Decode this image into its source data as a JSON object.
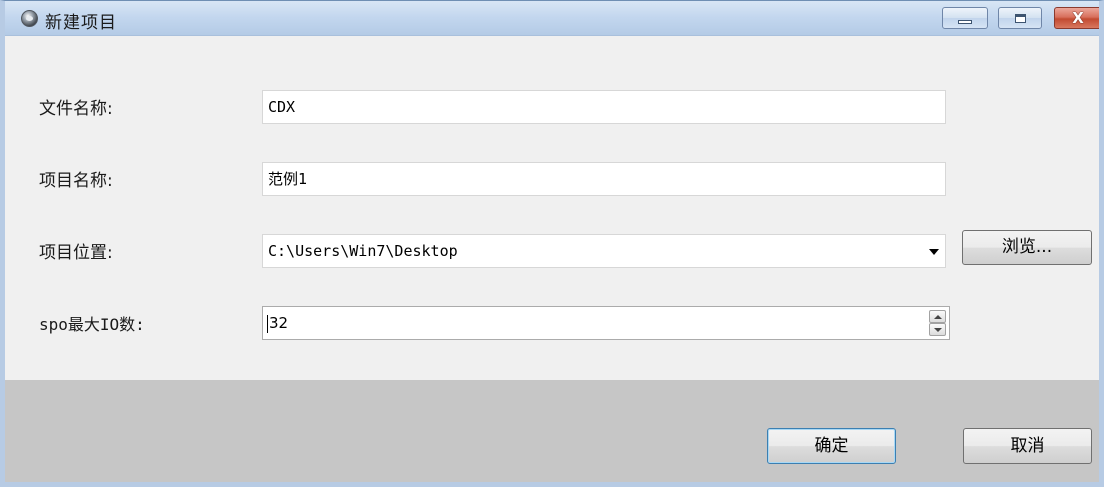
{
  "window": {
    "title": "新建项目",
    "controls": {
      "minimize": "minimize",
      "maximize": "maximize",
      "close": "X"
    }
  },
  "form": {
    "file_name": {
      "label": "文件名称:",
      "value": "CDX"
    },
    "project_name": {
      "label": "项目名称:",
      "value": "范例1"
    },
    "project_location": {
      "label": "项目位置:",
      "value": "C:\\Users\\Win7\\Desktop",
      "browse_label": "浏览..."
    },
    "spo_max_io": {
      "label": "spo最大IO数:",
      "value": "32"
    }
  },
  "footer": {
    "ok_label": "确定",
    "cancel_label": "取消"
  },
  "icons": [
    "app-icon",
    "minimize-icon",
    "maximize-icon",
    "close-icon",
    "dropdown-arrow-icon",
    "spin-up-icon",
    "spin-down-icon"
  ],
  "colors": {
    "titlebar": "#c2d6ee",
    "content_bg": "#f0f0f0",
    "footer_bg": "#c6c6c6",
    "close_button": "#c24a31"
  }
}
